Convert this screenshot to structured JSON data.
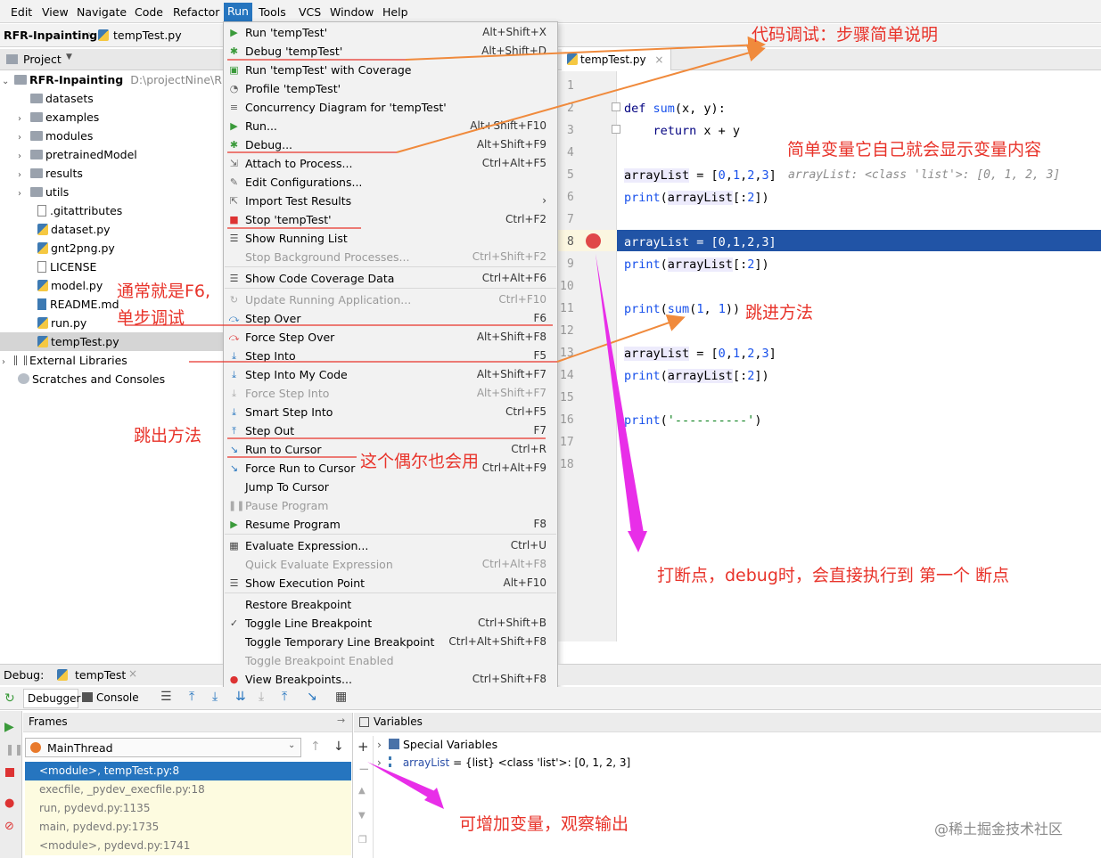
{
  "menubar": {
    "items": [
      "Edit",
      "View",
      "Navigate",
      "Code",
      "Refactor",
      "Run",
      "Tools",
      "VCS",
      "Window",
      "Help"
    ]
  },
  "navbar": {
    "project": "RFR-Inpainting",
    "file": "tempTest.py"
  },
  "project_panel": {
    "title": "Project",
    "root": "RFR-Inpainting",
    "root_path": "D:\\projectNine\\RFR-",
    "items": [
      "datasets",
      "examples",
      "modules",
      "pretrainedModel",
      "results",
      "utils",
      ".gitattributes",
      "dataset.py",
      "gnt2png.py",
      "LICENSE",
      "model.py",
      "README.md",
      "run.py",
      "tempTest.py",
      "External Libraries",
      "Scratches and Consoles"
    ]
  },
  "run_menu": [
    {
      "label": "Run 'tempTest'",
      "shortcut": "Alt+Shift+X"
    },
    {
      "label": "Debug 'tempTest'",
      "shortcut": "Alt+Shift+D"
    },
    {
      "label": "Run 'tempTest' with Coverage",
      "shortcut": ""
    },
    {
      "label": "Profile 'tempTest'",
      "shortcut": ""
    },
    {
      "label": "Concurrency Diagram for 'tempTest'",
      "shortcut": ""
    },
    {
      "label": "Run...",
      "shortcut": "Alt+Shift+F10"
    },
    {
      "label": "Debug...",
      "shortcut": "Alt+Shift+F9"
    },
    {
      "label": "Attach to Process...",
      "shortcut": "Ctrl+Alt+F5"
    },
    {
      "label": "Edit Configurations...",
      "shortcut": ""
    },
    {
      "label": "Import Test Results",
      "shortcut": "›"
    },
    {
      "label": "Stop 'tempTest'",
      "shortcut": "Ctrl+F2"
    },
    {
      "label": "Show Running List",
      "shortcut": ""
    },
    {
      "label": "Stop Background Processes...",
      "shortcut": "Ctrl+Shift+F2"
    },
    {
      "label": "Show Code Coverage Data",
      "shortcut": "Ctrl+Alt+F6"
    },
    {
      "label": "Update Running Application...",
      "shortcut": "Ctrl+F10"
    },
    {
      "label": "Step Over",
      "shortcut": "F6"
    },
    {
      "label": "Force Step Over",
      "shortcut": "Alt+Shift+F8"
    },
    {
      "label": "Step Into",
      "shortcut": "F5"
    },
    {
      "label": "Step Into My Code",
      "shortcut": "Alt+Shift+F7"
    },
    {
      "label": "Force Step Into",
      "shortcut": "Alt+Shift+F7"
    },
    {
      "label": "Smart Step Into",
      "shortcut": "Ctrl+F5"
    },
    {
      "label": "Step Out",
      "shortcut": "F7"
    },
    {
      "label": "Run to Cursor",
      "shortcut": "Ctrl+R"
    },
    {
      "label": "Force Run to Cursor",
      "shortcut": "Ctrl+Alt+F9"
    },
    {
      "label": "Jump To Cursor",
      "shortcut": ""
    },
    {
      "label": "Pause Program",
      "shortcut": ""
    },
    {
      "label": "Resume Program",
      "shortcut": "F8"
    },
    {
      "label": "Evaluate Expression...",
      "shortcut": "Ctrl+U"
    },
    {
      "label": "Quick Evaluate Expression",
      "shortcut": "Ctrl+Alt+F8"
    },
    {
      "label": "Show Execution Point",
      "shortcut": "Alt+F10"
    },
    {
      "label": "Restore Breakpoint",
      "shortcut": ""
    },
    {
      "label": "Toggle Line Breakpoint",
      "shortcut": "Ctrl+Shift+B"
    },
    {
      "label": "Toggle Temporary Line Breakpoint",
      "shortcut": "Ctrl+Alt+Shift+F8"
    },
    {
      "label": "Toggle Breakpoint Enabled",
      "shortcut": ""
    },
    {
      "label": "View Breakpoints...",
      "shortcut": "Ctrl+Shift+F8"
    }
  ],
  "editor": {
    "tab": "tempTest.py",
    "inline_hint": "arrayList: <class 'list'>: [0, 1, 2, 3]"
  },
  "annotations": {
    "debug_steps": "代码调试：步骤简单说明",
    "simple_var": "简单变量它自己就会显示变量内容",
    "f6_line1": "通常就是F6,",
    "f6_line2": "单步调试",
    "step_into": "跳进方法",
    "step_out": "跳出方法",
    "run_to_cursor": "这个偶尔也会用",
    "breakpoint": "打断点，debug时，会直接执行到 第一个 断点",
    "add_var": "可增加变量，观察输出"
  },
  "debug": {
    "label": "Debug:",
    "tab": "tempTest",
    "debugger_tab": "Debugger",
    "console_tab": "Console",
    "frames_title": "Frames",
    "thread": "MainThread",
    "variables_title": "Variables",
    "frames": [
      "<module>, tempTest.py:8",
      "execfile, _pydev_execfile.py:18",
      "run, pydevd.py:1135",
      "main, pydevd.py:1735",
      "<module>, pydevd.py:1741"
    ],
    "special_vars": "Special Variables",
    "var_name": "arrayList",
    "var_value": " = {list} <class 'list'>: [0, 1, 2, 3]"
  },
  "watermark": "@稀土掘金技术社区"
}
